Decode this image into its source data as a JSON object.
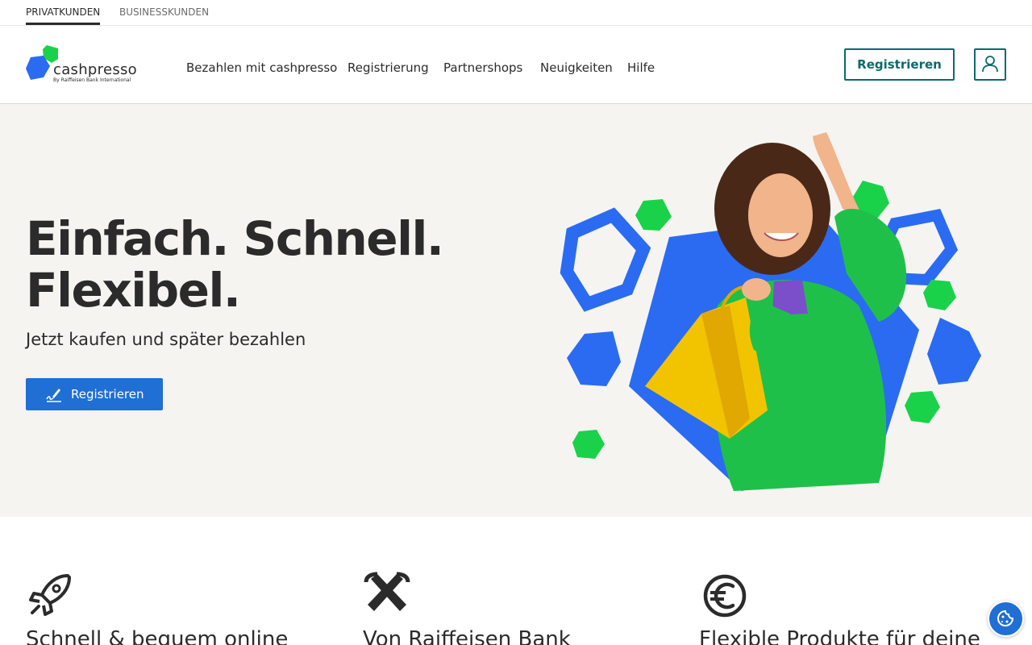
{
  "segments": {
    "private": "PRIVATKUNDEN",
    "business": "BUSINESSKUNDEN"
  },
  "brand": {
    "name": "cashpresso",
    "tagline": "By Raiffeisen Bank International",
    "colors": {
      "blue": "#2a6bf2",
      "green": "#19d24a",
      "teal": "#0a6b6b",
      "cta": "#1f6fd4"
    }
  },
  "nav": {
    "items": [
      "Bezahlen mit cashpresso",
      "Registrierung",
      "Partnershops",
      "Neuigkeiten",
      "Hilfe"
    ],
    "register": "Registrieren",
    "account_icon": "user-icon"
  },
  "hero": {
    "title_line1": "Einfach. Schnell.",
    "title_line2": "Flexibel.",
    "subtitle": "Jetzt kaufen und später bezahlen",
    "cta": "Registrieren",
    "cta_icon": "signature-icon"
  },
  "features": [
    {
      "icon": "rocket-icon",
      "title": "Schnell & bequem online"
    },
    {
      "icon": "raiffeisen-gable-icon",
      "title": "Von Raiffeisen Bank"
    },
    {
      "icon": "euro-icon",
      "title": "Flexible Produkte für deine"
    }
  ],
  "cookie_icon": "cookie-icon"
}
